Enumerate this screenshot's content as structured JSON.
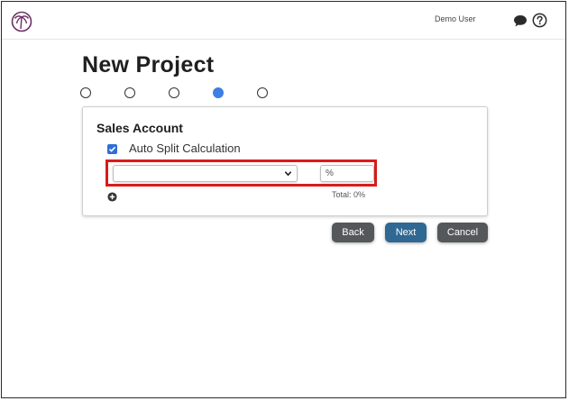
{
  "header": {
    "user_name": "Demo User",
    "icons": [
      "palm-logo-icon",
      "chat-icon",
      "help-icon"
    ]
  },
  "page": {
    "title": "New Project",
    "wizard": {
      "total_steps": 5,
      "current_step": 4
    }
  },
  "sales_account": {
    "title": "Sales Account",
    "auto_split_label": "Auto Split Calculation",
    "auto_split_checked": true,
    "account_select_value": "",
    "percent_placeholder": "%",
    "total_text": "Total: 0%"
  },
  "actions": {
    "back_label": "Back",
    "next_label": "Next",
    "cancel_label": "Cancel"
  },
  "colors": {
    "active_step": "#3d7fe8",
    "primary_button": "#2f6892",
    "secondary_button": "#55585a",
    "highlight": "#d91b1b",
    "logo": "#6b2f63"
  }
}
